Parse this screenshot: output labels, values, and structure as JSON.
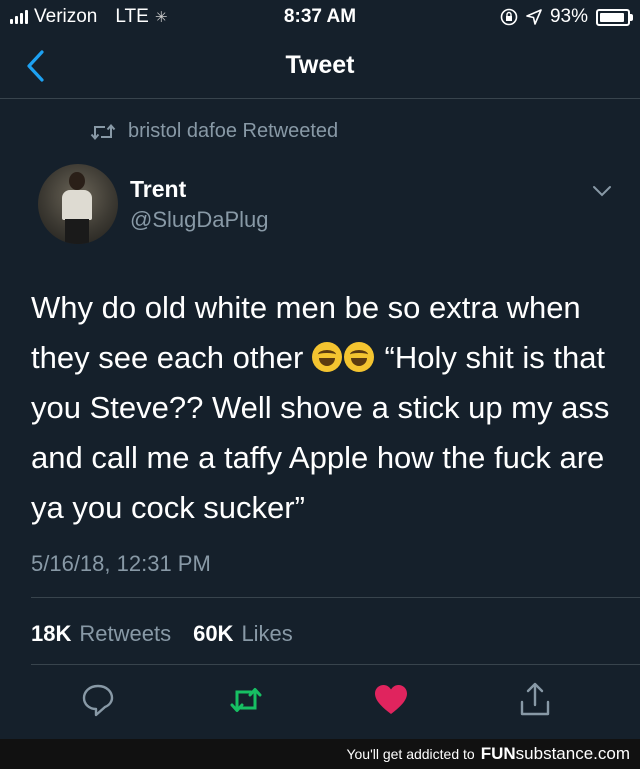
{
  "status_bar": {
    "carrier": "Verizon",
    "network": "LTE",
    "time": "8:37 AM",
    "battery": "93%",
    "battery_level": 0.93
  },
  "nav": {
    "title": "Tweet",
    "back_icon": "chevron-left-icon"
  },
  "retweet_context": {
    "text": "bristol dafoe Retweeted",
    "icon": "retweet-icon"
  },
  "tweet": {
    "author_name": "Trent",
    "author_handle": "@SlugDaPlug",
    "text_before_emoji": "Why do old white men be so extra when they see each other ",
    "emoji_name": "face-with-tears-of-joy",
    "emoji_count": 2,
    "text_after_emoji": " “Holy shit is that you Steve?? Well shove a stick up my ass and call me a taffy Apple how the fuck are ya you cock sucker”",
    "timestamp": "5/16/18, 12:31 PM",
    "retweets_count": "18K",
    "retweets_label": "Retweets",
    "likes_count": "60K",
    "likes_label": "Likes"
  },
  "actions": [
    {
      "icon": "reply-icon"
    },
    {
      "icon": "retweet-icon",
      "color": "#17bf63"
    },
    {
      "icon": "heart-icon",
      "color": "#e0245e"
    },
    {
      "icon": "share-icon"
    }
  ],
  "footer": {
    "tagline": "You'll get addicted to",
    "brand_bold": "FUN",
    "brand_rest": "substance.com"
  },
  "colors": {
    "background": "#15202b",
    "accent": "#1da1f2",
    "secondary_text": "#8899a6",
    "retweet_green": "#17bf63",
    "like_red": "#e0245e"
  }
}
